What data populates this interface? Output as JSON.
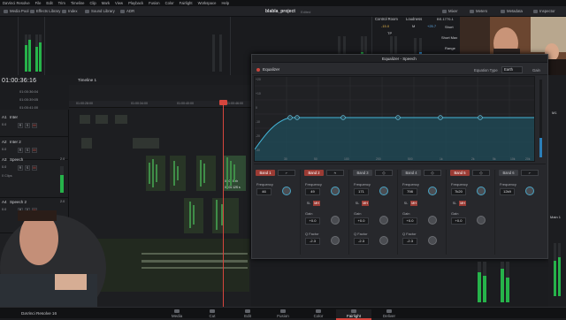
{
  "menu": [
    "DaVinci Resolve",
    "File",
    "Edit",
    "Trim",
    "Timeline",
    "Clip",
    "Mark",
    "View",
    "Playback",
    "Fusion",
    "Color",
    "Fairlight",
    "Workspace",
    "Help"
  ],
  "toolbar": {
    "media_pool": "Media Pool",
    "effects": "Effects Library",
    "index": "Index",
    "sound": "Sound Library",
    "adr": "ADR",
    "project": "blabla_project",
    "state": "Edited",
    "mixer": "Mixer",
    "meters": "Meters",
    "metadata": "Metadata",
    "inspector": "Inspector"
  },
  "top": {
    "control_room": "Control Room",
    "loudness": "Loudness",
    "bs": "BS.1770-1",
    "ctl_val": "-15.0",
    "loud_val": "+25.7",
    "short_label": "Short",
    "short_max": "Short Max",
    "range": "Range",
    "m_label": "M",
    "tp_label": "TP",
    "m2_label": "M",
    "i_label": "I"
  },
  "timeline": {
    "timecode": "01:00:36:16",
    "sub1": "01:00:36:04",
    "sub2": "01:00:39:05",
    "sub3": "01:00:41:00",
    "name": "Timeline 1",
    "ruler": [
      "01:00:28:00",
      "01:00:34:00",
      "01:00:40:00",
      "01:00:46:00"
    ],
    "clip_lbl1": "00:01 Ehh",
    "clip_lbl2": "00:01 12S s"
  },
  "tracks": [
    {
      "id": "A1",
      "name": "Inter",
      "vol": "0.0",
      "clips": ""
    },
    {
      "id": "A2",
      "name": "Inter 2",
      "vol": "0.0",
      "clips": ""
    },
    {
      "id": "A3",
      "name": "Speech",
      "vol": "0.0",
      "clips": "0 Clips"
    },
    {
      "id": "A4",
      "name": "Speech 2",
      "vol": "0.0",
      "clips": ""
    }
  ],
  "track_extra": {
    "a3_right": "2.0",
    "a4_right": "2.0"
  },
  "eq": {
    "title": "Equalizer - Speech",
    "name": "Equalizer",
    "type_label": "Equation Type",
    "type_value": "Earth",
    "gain_label": "Gain",
    "bands": [
      {
        "label": "Band 1",
        "on": true,
        "shape": "⌐",
        "freq": "46",
        "gain": "",
        "q": ""
      },
      {
        "label": "Band 2",
        "on": true,
        "shape": "≈",
        "freq": "49",
        "gain": "+0.0",
        "q": "-2.3"
      },
      {
        "label": "Band 3",
        "on": false,
        "shape": "◇",
        "freq": "171",
        "gain": "+0.0",
        "q": "-2.3"
      },
      {
        "label": "Band 4",
        "on": false,
        "shape": "◇",
        "freq": "798",
        "gain": "+0.0",
        "q": "-2.3"
      },
      {
        "label": "Band 5",
        "on": true,
        "shape": "◇",
        "freq": "7k20",
        "gain": "+0.0",
        "q": ""
      },
      {
        "label": "Band 6",
        "on": false,
        "shape": "⌐",
        "freq": "12k9",
        "gain": "",
        "q": ""
      }
    ],
    "freq_label": "Frequency",
    "gain_lbl": "Gain",
    "q_label": "Q Factor",
    "graph_y": [
      "+20",
      "+10",
      "0",
      "-10",
      "-20",
      "-30"
    ],
    "graph_x": [
      "30",
      "50",
      "100",
      "200",
      "500",
      "1k",
      "2k",
      "5k",
      "10k",
      "20k"
    ]
  },
  "right": {
    "m1": "M1",
    "main": "Main 1"
  },
  "pages": [
    "Media",
    "Cut",
    "Edit",
    "Fusion",
    "Color",
    "Fairlight",
    "Deliver"
  ],
  "brand": "DaVinci Resolve 16"
}
